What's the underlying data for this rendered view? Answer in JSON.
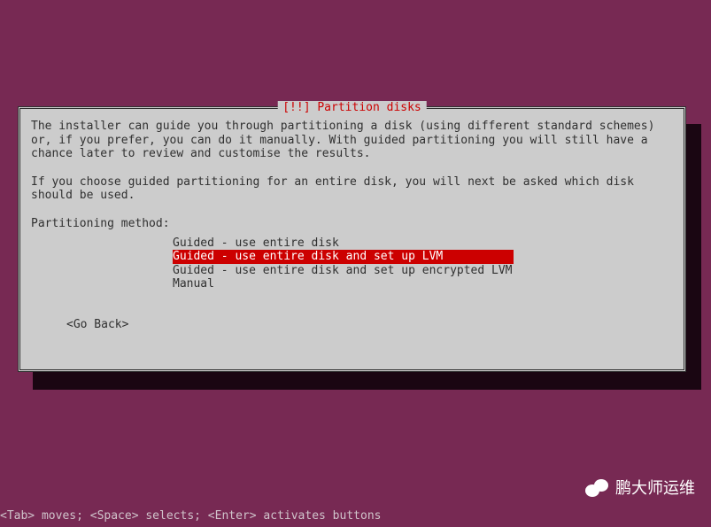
{
  "dialog": {
    "title": "[!!] Partition disks",
    "intro": "The installer can guide you through partitioning a disk (using different standard schemes) or, if you prefer, you can do it manually. With guided partitioning you will still have a chance later to review and customise the results.",
    "note": "If you choose guided partitioning for an entire disk, you will next be asked which disk should be used.",
    "method_label": "Partitioning method:",
    "options": {
      "opt0": "Guided - use entire disk",
      "opt1": "Guided - use entire disk and set up LVM",
      "opt2": "Guided - use entire disk and set up encrypted LVM",
      "opt3": "Manual"
    },
    "go_back": "<Go Back>"
  },
  "footer": {
    "help": "<Tab> moves; <Space> selects; <Enter> activates buttons"
  },
  "watermark": {
    "text": "鹏大师运维"
  }
}
